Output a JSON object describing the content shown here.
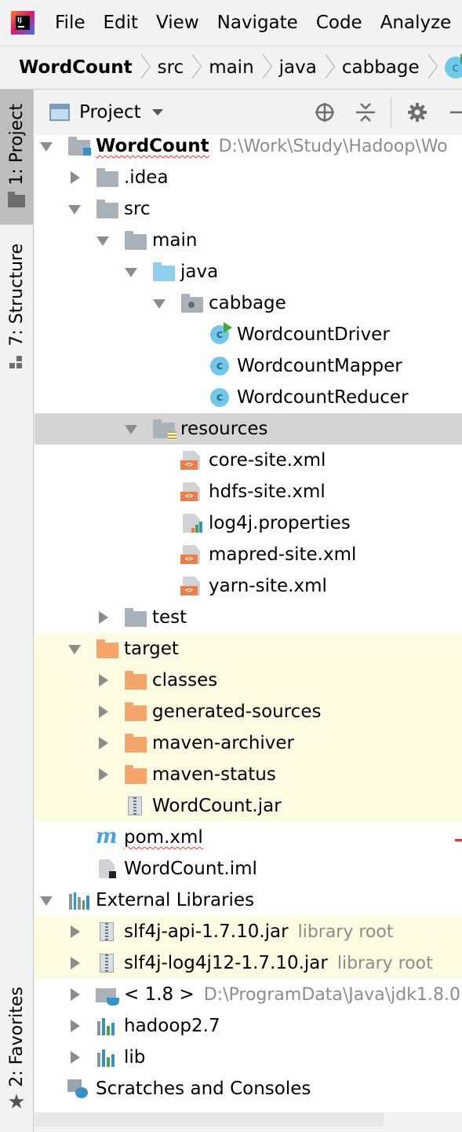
{
  "menubar": {
    "items": [
      "File",
      "Edit",
      "View",
      "Navigate",
      "Code",
      "Analyze"
    ]
  },
  "breadcrumb": {
    "items": [
      "WordCount",
      "src",
      "main",
      "java",
      "cabbage"
    ],
    "class_icon_letter": "c"
  },
  "toolstrip": {
    "project_tab": "1: Project",
    "structure_tab": "7: Structure",
    "favorites_tab": "2: Favorites"
  },
  "project_header": {
    "title": "Project"
  },
  "tree": {
    "root": {
      "name": "WordCount",
      "path": "D:\\Work\\Study\\Hadoop\\Wo"
    },
    "idea": ".idea",
    "src": "src",
    "main": "main",
    "java": "java",
    "cabbage": "cabbage",
    "classes": [
      "WordcountDriver",
      "WordcountMapper",
      "WordcountReducer"
    ],
    "class_letter": "c",
    "resources": "resources",
    "resource_files": [
      "core-site.xml",
      "hdfs-site.xml",
      "log4j.properties",
      "mapred-site.xml",
      "yarn-site.xml"
    ],
    "test": "test",
    "target": "target",
    "target_children": [
      "classes",
      "generated-sources",
      "maven-archiver",
      "maven-status"
    ],
    "jar": "WordCount.jar",
    "pom": "pom.xml",
    "maven_letter": "m",
    "iml": "WordCount.iml",
    "external_libraries": "External Libraries",
    "libs": [
      {
        "name": "slf4j-api-1.7.10.jar",
        "hint": "library root"
      },
      {
        "name": "slf4j-log4j12-1.7.10.jar",
        "hint": "library root"
      }
    ],
    "jdk": {
      "name": "< 1.8 >",
      "path": "D:\\ProgramData\\Java\\jdk1.8.0"
    },
    "hadoop": "hadoop2.7",
    "lib": "lib",
    "scratches": "Scratches and Consoles"
  },
  "colors": {
    "excluded_bg": "#fdfbe2",
    "selected_bg": "#d4d4d4",
    "folder_grey": "#a9b1b9",
    "folder_blue": "#8fd0ee",
    "folder_orange": "#f6a66b",
    "class_icon": "#6fc7e9",
    "xml_badge": "#e97e4a"
  }
}
